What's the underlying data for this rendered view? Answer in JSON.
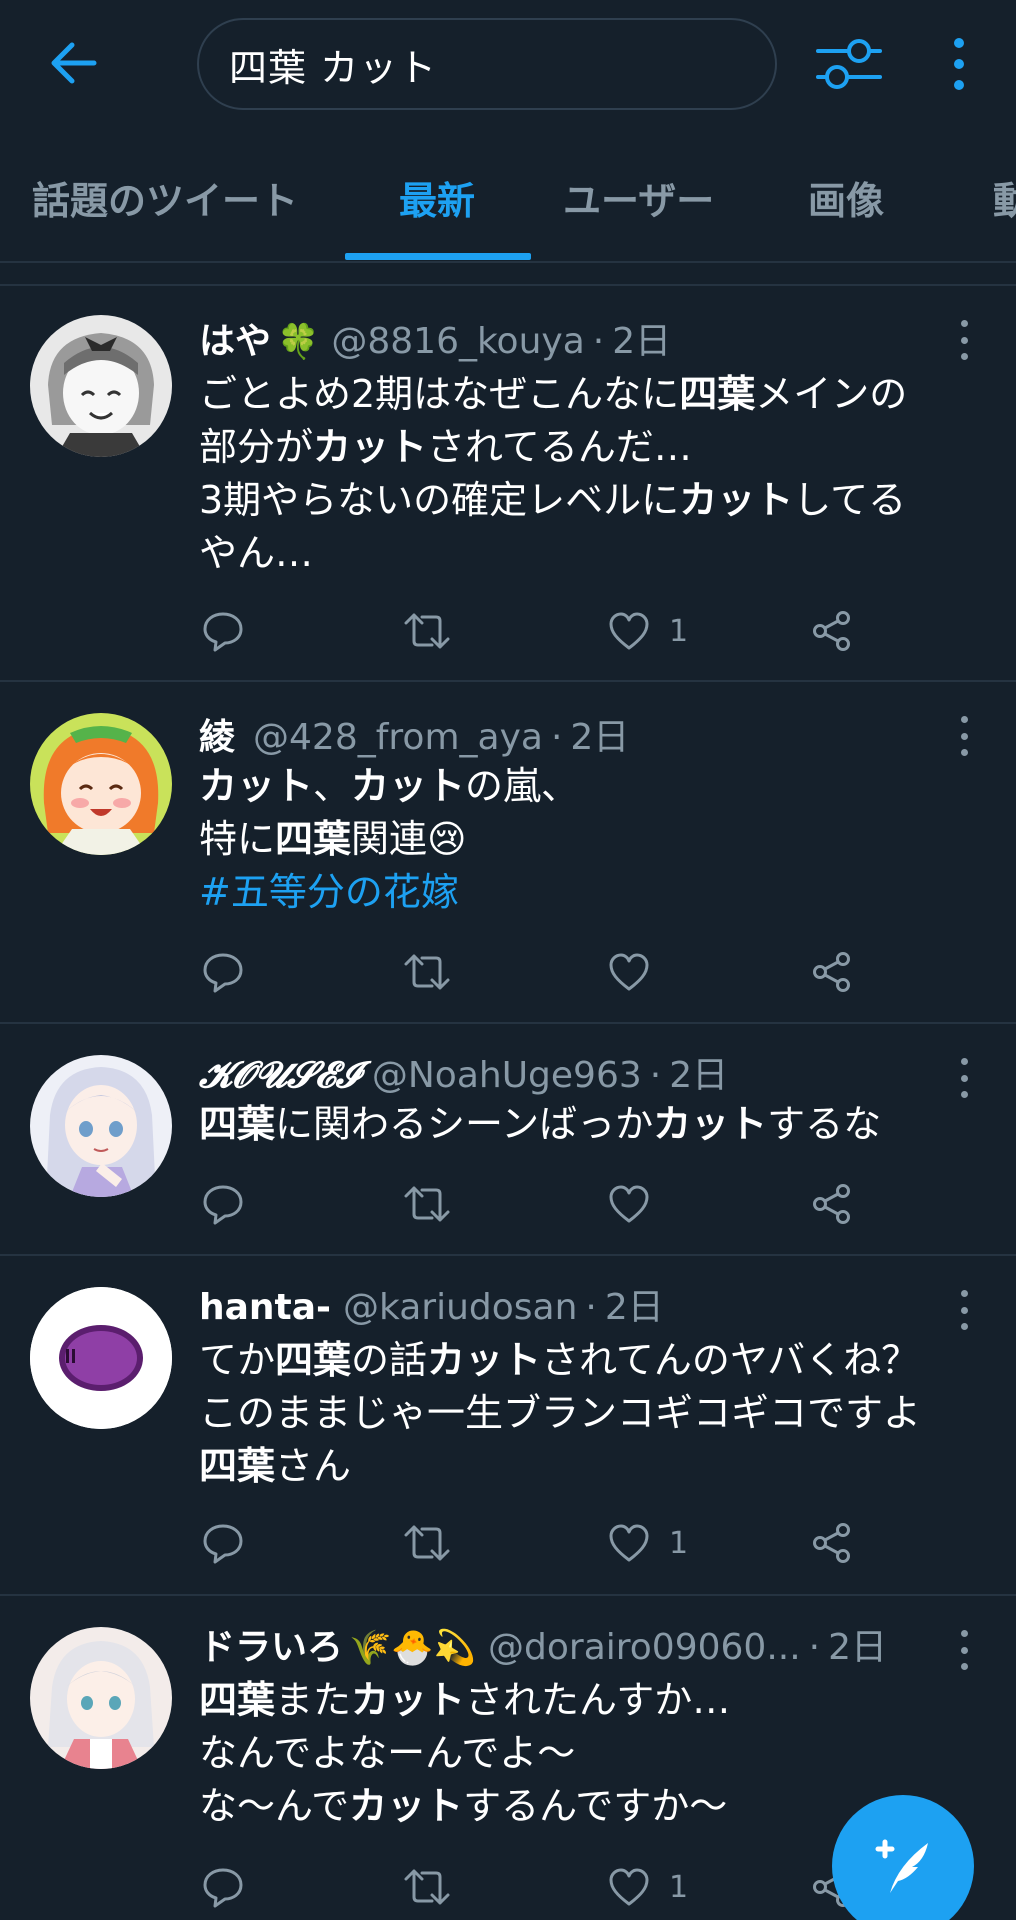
{
  "search": {
    "query": "四葉 カット"
  },
  "tabs": [
    {
      "label": "話題のツイート",
      "active": false
    },
    {
      "label": "最新",
      "active": true
    },
    {
      "label": "ユーザー",
      "active": false
    },
    {
      "label": "画像",
      "active": false
    },
    {
      "label": "動",
      "active": false
    }
  ],
  "colors": {
    "background": "#15202b",
    "accent": "#1da1f2",
    "secondary_text": "#8899a6",
    "divider": "#253341"
  },
  "tweets": [
    {
      "name": "はや",
      "emoji": "🍀",
      "handle": "@8816_kouya",
      "time": "2日",
      "lines": [
        [
          {
            "t": "ごとよめ2期はなぜこんなに"
          },
          {
            "t": "四葉",
            "b": true
          },
          {
            "t": "メインの"
          }
        ],
        [
          {
            "t": "部分が"
          },
          {
            "t": "カット",
            "b": true
          },
          {
            "t": "されてるんだ…"
          }
        ],
        [
          {
            "t": "3期やらないの確定レベルに"
          },
          {
            "t": "カット",
            "b": true
          },
          {
            "t": "してる"
          }
        ],
        [
          {
            "t": "やん…"
          }
        ]
      ],
      "likes": "1"
    },
    {
      "name": "綾",
      "emoji": "",
      "handle": "@428_from_aya",
      "time": "2日",
      "lines": [
        [
          {
            "t": "カット",
            "b": true
          },
          {
            "t": "、"
          },
          {
            "t": "カット",
            "b": true
          },
          {
            "t": "の嵐、"
          }
        ],
        [
          {
            "t": "特に"
          },
          {
            "t": "四葉",
            "b": true
          },
          {
            "t": "関連😢"
          }
        ],
        [
          {
            "t": "#五等分の花嫁",
            "h": true
          }
        ]
      ],
      "likes": ""
    },
    {
      "name": "𝓚𝓞𝓤𝓢𝓔𝓘",
      "emoji": "",
      "handle": "@NoahUge963",
      "time": "2日",
      "lines": [
        [
          {
            "t": "四葉",
            "b": true
          },
          {
            "t": "に関わるシーンばっか"
          },
          {
            "t": "カット",
            "b": true
          },
          {
            "t": "するな"
          }
        ]
      ],
      "likes": ""
    },
    {
      "name": "hanta-",
      "emoji": "",
      "handle": "@kariudosan",
      "time": "2日",
      "lines": [
        [
          {
            "t": "てか"
          },
          {
            "t": "四葉",
            "b": true
          },
          {
            "t": "の話"
          },
          {
            "t": "カット",
            "b": true
          },
          {
            "t": "されてんのヤバくね？"
          }
        ],
        [
          {
            "t": "このままじゃ一生ブランコギコギコですよ"
          }
        ],
        [
          {
            "t": "四葉",
            "b": true
          },
          {
            "t": "さん"
          }
        ]
      ],
      "likes": "1"
    },
    {
      "name": "ドラいろ",
      "emoji": "🌾🐣💫",
      "handle": "@dorairo09060...",
      "time": "2日",
      "lines": [
        [
          {
            "t": "四葉",
            "b": true
          },
          {
            "t": "また"
          },
          {
            "t": "カット",
            "b": true
          },
          {
            "t": "されたんすか…"
          }
        ],
        [
          {
            "t": "なんでよなーんでよ〜"
          }
        ],
        [
          {
            "t": "な〜んで"
          },
          {
            "t": "カット",
            "b": true
          },
          {
            "t": "するんですか〜"
          }
        ]
      ],
      "likes": "1"
    }
  ]
}
